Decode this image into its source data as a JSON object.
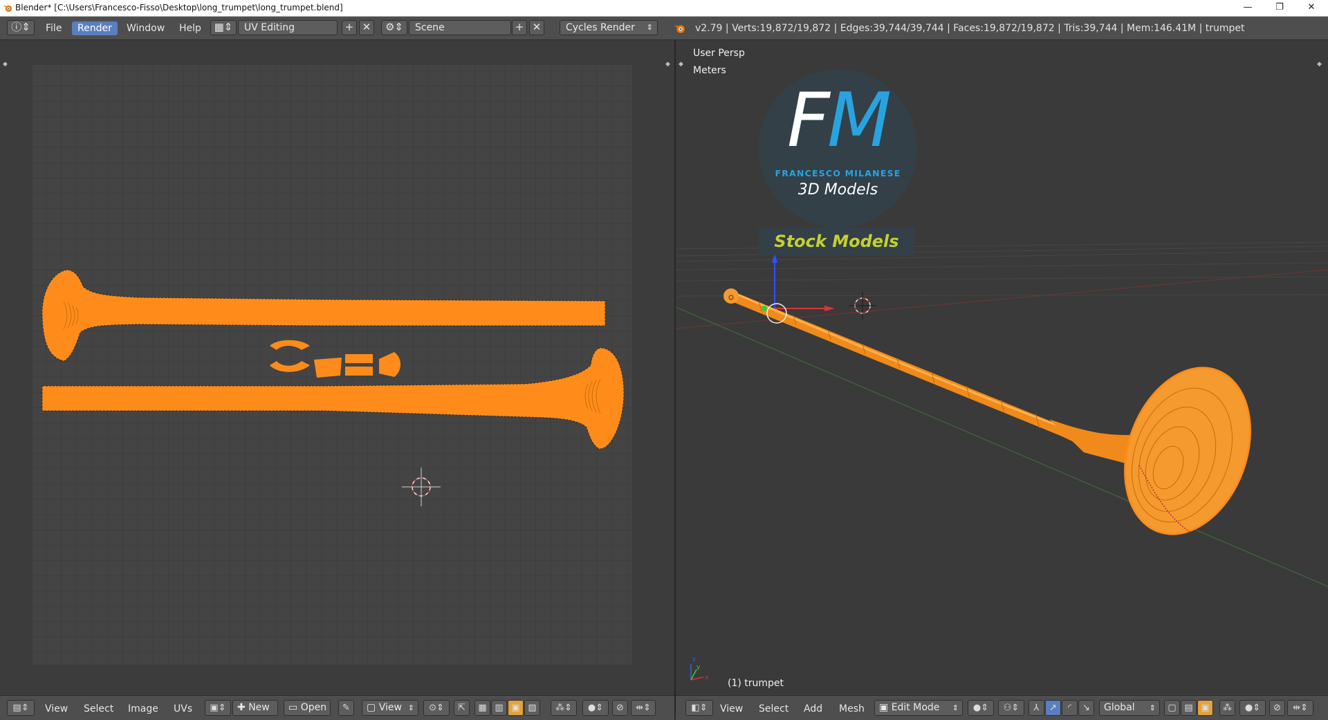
{
  "window": {
    "title": "Blender* [C:\\Users\\Francesco-Fisso\\Desktop\\long_trumpet\\long_trumpet.blend]",
    "minimize": "—",
    "maximize": "❐",
    "close": "✕"
  },
  "menu": {
    "items": [
      "File",
      "Render",
      "Window",
      "Help"
    ],
    "active": "Render"
  },
  "layout": {
    "value": "UV Editing"
  },
  "scene": {
    "value": "Scene"
  },
  "engine": {
    "value": "Cycles Render"
  },
  "stats": "v2.79 | Verts:19,872/19,872 | Edges:39,744/39,744 | Faces:19,872/19,872 | Tris:39,744 | Mem:146.41M | trumpet",
  "viewport": {
    "perspective": "User Persp",
    "units": "Meters",
    "object_label": "(1) trumpet"
  },
  "logo": {
    "letters_f": "F",
    "letters_m": "M",
    "brand": "FRANCESCO MILANESE",
    "subtitle": "3D Models",
    "banner": "Stock Models"
  },
  "uv_footer": {
    "view": "View",
    "select": "Select",
    "image": "Image",
    "uvs": "UVs",
    "new": "New",
    "open": "Open",
    "view_menu": "View"
  },
  "vp_footer": {
    "view": "View",
    "select": "Select",
    "add": "Add",
    "mesh": "Mesh",
    "mode": "Edit Mode",
    "orientation": "Global"
  },
  "colors": {
    "mesh_orange": "#ff8c1a",
    "accent_blue": "#5a7fbf",
    "logo_blue": "#29a3e0",
    "banner_yellow": "#c7d02d"
  }
}
